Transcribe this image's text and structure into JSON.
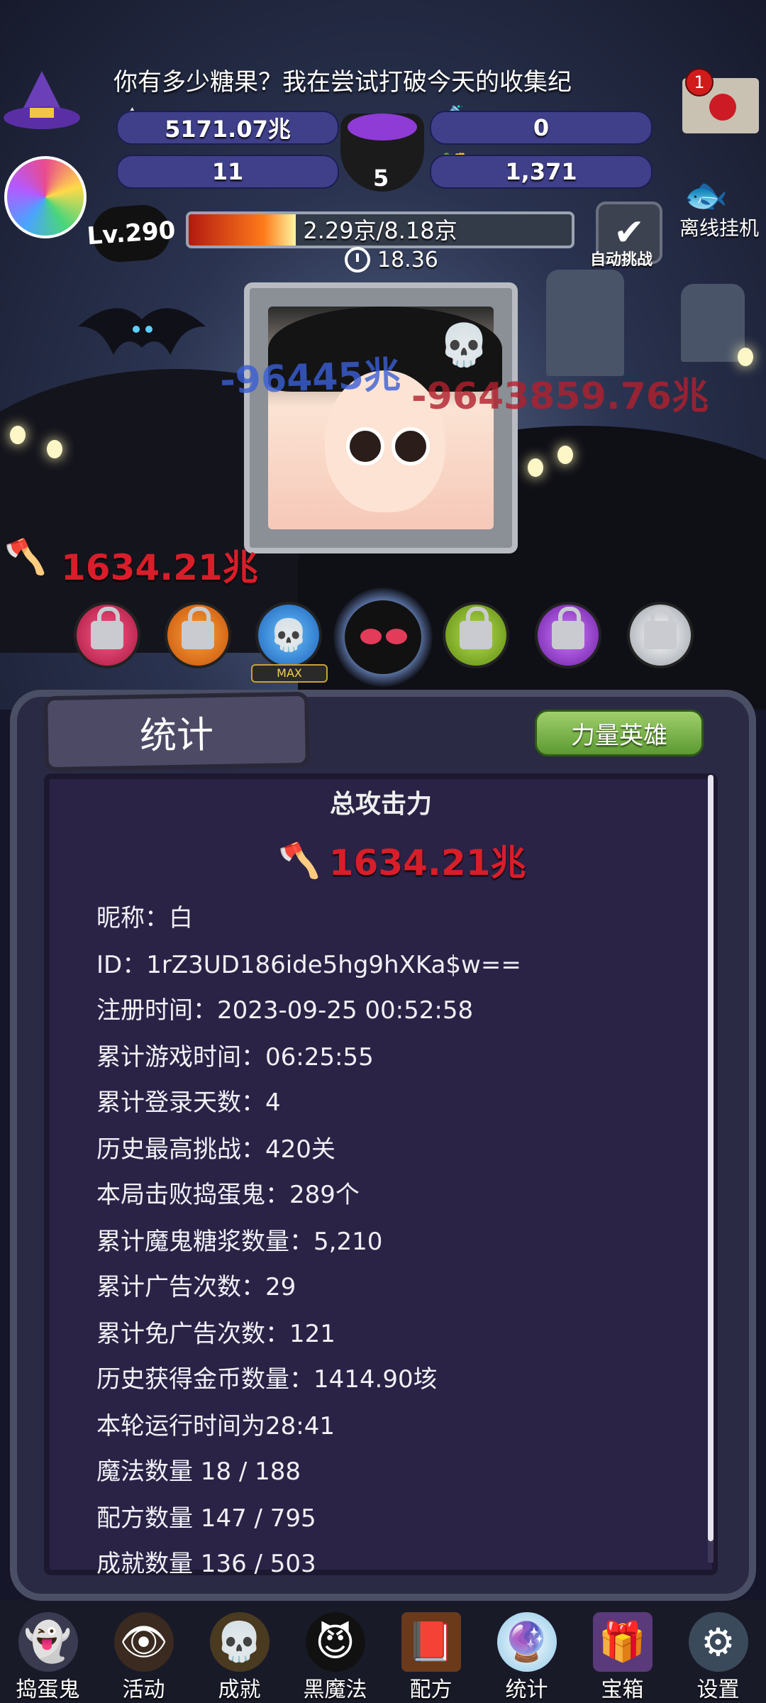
{
  "header": {
    "banner_text": "你有多少糖果？我在尝试打破今天的收集纪",
    "mail_badge": "1"
  },
  "resources": {
    "candy_total": "5171.07兆",
    "potion": "0",
    "bow_candy": "11",
    "cauldron_count": "5",
    "candy_corn": "1,371"
  },
  "level": {
    "badge": "Lv.290",
    "xp_text": "2.29京/8.18京",
    "xp_fraction": 0.28,
    "timer": "18.36"
  },
  "buttons": {
    "auto_challenge": "自动挑战",
    "offline": "离线挂机"
  },
  "battle": {
    "damage_blue": "-96445兆",
    "damage_red": "-9643859.76兆",
    "left_attack": "1634.21兆"
  },
  "heroes": {
    "max_tag": "MAX"
  },
  "tabs": {
    "stats": "统计",
    "power_heroes": "力量英雄"
  },
  "stats": {
    "total_title": "总攻击力",
    "total_value": "1634.21兆",
    "lines": [
      "昵称：白",
      "ID：1rZ3UD186ide5hg9hXKa$w==",
      "注册时间：2023-09-25 00:52:58",
      "累计游戏时间：06:25:55",
      "累计登录天数：4",
      "历史最高挑战：420关",
      "本局击败捣蛋鬼：289个",
      "累计魔鬼糖浆数量：5,210",
      "累计广告次数：29",
      "累计免广告次数：121",
      "历史获得金币数量：1414.90垓",
      "本轮运行时间为28:41",
      "魔法数量 18 / 188",
      "配方数量 147 / 795",
      "成就数量 136 / 503"
    ]
  },
  "nav": [
    {
      "label": "捣蛋鬼",
      "icon": "ghost-icon"
    },
    {
      "label": "活动",
      "icon": "eyeball-bowl-icon"
    },
    {
      "label": "成就",
      "icon": "skull-trophy-icon"
    },
    {
      "label": "黑魔法",
      "icon": "devil-icon"
    },
    {
      "label": "配方",
      "icon": "recipe-book-icon"
    },
    {
      "label": "统计",
      "icon": "crystal-ball-icon"
    },
    {
      "label": "宝箱",
      "icon": "treasure-chest-icon"
    },
    {
      "label": "设置",
      "icon": "gear-icon"
    }
  ]
}
